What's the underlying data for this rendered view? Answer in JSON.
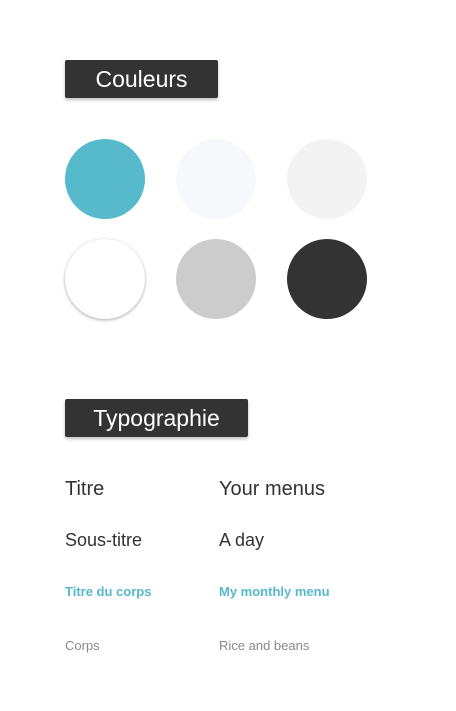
{
  "colors_section": {
    "title": "Couleurs",
    "swatches": [
      {
        "name": "teal",
        "color": "#56b9cc"
      },
      {
        "name": "ghost-white",
        "color": "#f6f8fc"
      },
      {
        "name": "light-gray",
        "color": "#f3f3f3"
      },
      {
        "name": "white",
        "color": "#ffffff"
      },
      {
        "name": "silver",
        "color": "#cccccc"
      },
      {
        "name": "charcoal",
        "color": "#333333"
      }
    ]
  },
  "typography_section": {
    "title": "Typographie",
    "rows": [
      {
        "style": "title",
        "label": "Titre",
        "sample": "Your menus"
      },
      {
        "style": "subtitle",
        "label": "Sous-titre",
        "sample": "A day"
      },
      {
        "style": "body-title",
        "label": "Titre du corps",
        "sample": "My monthly menu"
      },
      {
        "style": "body",
        "label": "Corps",
        "sample": "Rice and beans"
      }
    ]
  },
  "accent_color": "#56b9cc",
  "text_color": "#333333"
}
